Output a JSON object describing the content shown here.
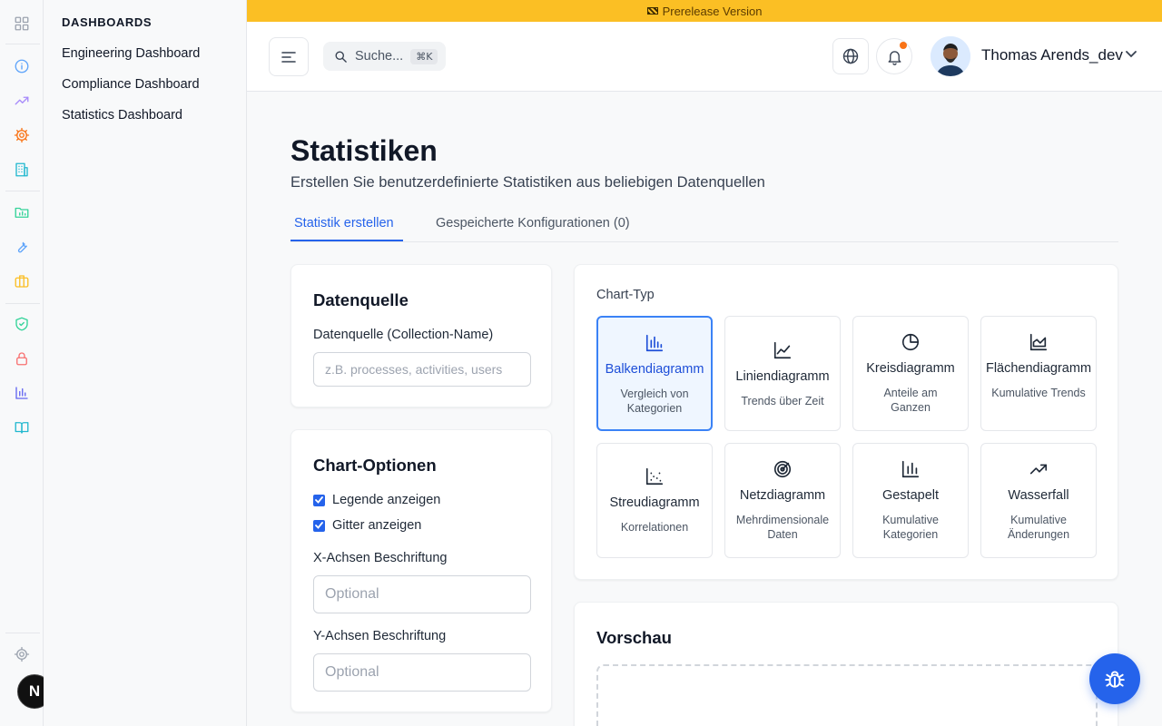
{
  "banner": {
    "text": "Prerelease Version"
  },
  "rail": {
    "icons": [
      "apps-icon",
      "info-icon",
      "trending-up-icon",
      "gear-icon",
      "building-icon",
      "folder-chart-icon",
      "wrench-icon",
      "briefcase-icon",
      "shield-check-icon",
      "lock-icon",
      "bar-chart-icon",
      "book-icon"
    ],
    "settings_icon": "settings-icon",
    "badge": "N"
  },
  "sidenav": {
    "heading": "DASHBOARDS",
    "items": [
      {
        "label": "Engineering Dashboard"
      },
      {
        "label": "Compliance Dashboard"
      },
      {
        "label": "Statistics Dashboard"
      }
    ]
  },
  "header": {
    "search_label": "Suche...",
    "search_shortcut": "⌘K",
    "user_name": "Thomas Arends_dev"
  },
  "page": {
    "title": "Statistiken",
    "subtitle": "Erstellen Sie benutzerdefinierte Statistiken aus beliebigen Datenquellen"
  },
  "tabs": [
    {
      "label": "Statistik erstellen",
      "active": true
    },
    {
      "label": "Gespeicherte Konfigurationen (0)",
      "active": false
    }
  ],
  "datasource": {
    "title": "Datenquelle",
    "field_label": "Datenquelle (Collection-Name)",
    "placeholder": "z.B. processes, activities, users"
  },
  "chart_options": {
    "title": "Chart-Optionen",
    "legend_label": "Legende anzeigen",
    "legend_checked": true,
    "grid_label": "Gitter anzeigen",
    "grid_checked": true,
    "x_label": "X-Achsen Beschriftung",
    "x_placeholder": "Optional",
    "y_label": "Y-Achsen Beschriftung",
    "y_placeholder": "Optional"
  },
  "chart_type": {
    "label": "Chart-Typ",
    "types": [
      {
        "name": "Balkendiagramm",
        "desc": "Vergleich von Kategorien",
        "icon": "bar-chart-icon",
        "selected": true
      },
      {
        "name": "Liniendiagramm",
        "desc": "Trends über Zeit",
        "icon": "line-chart-icon",
        "selected": false
      },
      {
        "name": "Kreisdiagramm",
        "desc": "Anteile am Ganzen",
        "icon": "pie-chart-icon",
        "selected": false
      },
      {
        "name": "Flächendiagramm",
        "desc": "Kumulative Trends",
        "icon": "area-chart-icon",
        "selected": false
      },
      {
        "name": "Streudiagramm",
        "desc": "Korrelationen",
        "icon": "scatter-chart-icon",
        "selected": false
      },
      {
        "name": "Netzdiagramm",
        "desc": "Mehrdimensionale Daten",
        "icon": "radar-chart-icon",
        "selected": false
      },
      {
        "name": "Gestapelt",
        "desc": "Kumulative Kategorien",
        "icon": "stacked-chart-icon",
        "selected": false
      },
      {
        "name": "Wasserfall",
        "desc": "Kumulative Änderungen",
        "icon": "waterfall-icon",
        "selected": false
      }
    ]
  },
  "preview": {
    "title": "Vorschau"
  },
  "colors": {
    "accent": "#2563eb",
    "banner": "#fbbf24",
    "notification": "#f97316"
  }
}
